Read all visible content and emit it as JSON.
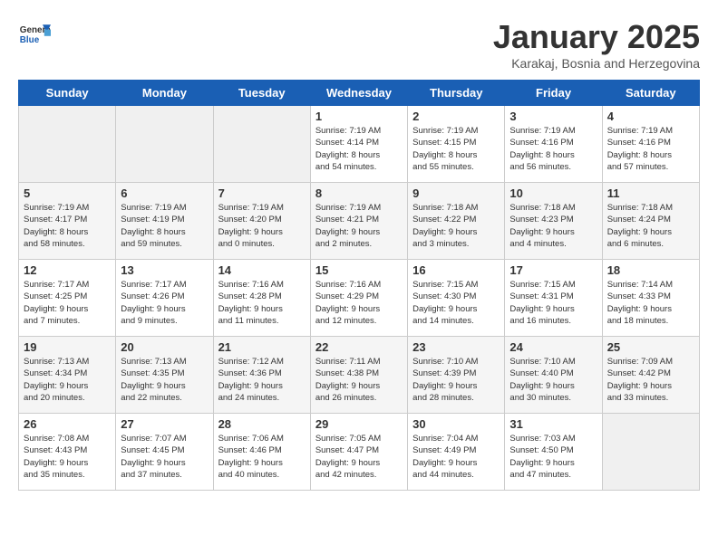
{
  "logo": {
    "general": "General",
    "blue": "Blue"
  },
  "title": "January 2025",
  "subtitle": "Karakaj, Bosnia and Herzegovina",
  "headers": [
    "Sunday",
    "Monday",
    "Tuesday",
    "Wednesday",
    "Thursday",
    "Friday",
    "Saturday"
  ],
  "weeks": [
    [
      {
        "num": "",
        "info": ""
      },
      {
        "num": "",
        "info": ""
      },
      {
        "num": "",
        "info": ""
      },
      {
        "num": "1",
        "info": "Sunrise: 7:19 AM\nSunset: 4:14 PM\nDaylight: 8 hours\nand 54 minutes."
      },
      {
        "num": "2",
        "info": "Sunrise: 7:19 AM\nSunset: 4:15 PM\nDaylight: 8 hours\nand 55 minutes."
      },
      {
        "num": "3",
        "info": "Sunrise: 7:19 AM\nSunset: 4:16 PM\nDaylight: 8 hours\nand 56 minutes."
      },
      {
        "num": "4",
        "info": "Sunrise: 7:19 AM\nSunset: 4:16 PM\nDaylight: 8 hours\nand 57 minutes."
      }
    ],
    [
      {
        "num": "5",
        "info": "Sunrise: 7:19 AM\nSunset: 4:17 PM\nDaylight: 8 hours\nand 58 minutes."
      },
      {
        "num": "6",
        "info": "Sunrise: 7:19 AM\nSunset: 4:19 PM\nDaylight: 8 hours\nand 59 minutes."
      },
      {
        "num": "7",
        "info": "Sunrise: 7:19 AM\nSunset: 4:20 PM\nDaylight: 9 hours\nand 0 minutes."
      },
      {
        "num": "8",
        "info": "Sunrise: 7:19 AM\nSunset: 4:21 PM\nDaylight: 9 hours\nand 2 minutes."
      },
      {
        "num": "9",
        "info": "Sunrise: 7:18 AM\nSunset: 4:22 PM\nDaylight: 9 hours\nand 3 minutes."
      },
      {
        "num": "10",
        "info": "Sunrise: 7:18 AM\nSunset: 4:23 PM\nDaylight: 9 hours\nand 4 minutes."
      },
      {
        "num": "11",
        "info": "Sunrise: 7:18 AM\nSunset: 4:24 PM\nDaylight: 9 hours\nand 6 minutes."
      }
    ],
    [
      {
        "num": "12",
        "info": "Sunrise: 7:17 AM\nSunset: 4:25 PM\nDaylight: 9 hours\nand 7 minutes."
      },
      {
        "num": "13",
        "info": "Sunrise: 7:17 AM\nSunset: 4:26 PM\nDaylight: 9 hours\nand 9 minutes."
      },
      {
        "num": "14",
        "info": "Sunrise: 7:16 AM\nSunset: 4:28 PM\nDaylight: 9 hours\nand 11 minutes."
      },
      {
        "num": "15",
        "info": "Sunrise: 7:16 AM\nSunset: 4:29 PM\nDaylight: 9 hours\nand 12 minutes."
      },
      {
        "num": "16",
        "info": "Sunrise: 7:15 AM\nSunset: 4:30 PM\nDaylight: 9 hours\nand 14 minutes."
      },
      {
        "num": "17",
        "info": "Sunrise: 7:15 AM\nSunset: 4:31 PM\nDaylight: 9 hours\nand 16 minutes."
      },
      {
        "num": "18",
        "info": "Sunrise: 7:14 AM\nSunset: 4:33 PM\nDaylight: 9 hours\nand 18 minutes."
      }
    ],
    [
      {
        "num": "19",
        "info": "Sunrise: 7:13 AM\nSunset: 4:34 PM\nDaylight: 9 hours\nand 20 minutes."
      },
      {
        "num": "20",
        "info": "Sunrise: 7:13 AM\nSunset: 4:35 PM\nDaylight: 9 hours\nand 22 minutes."
      },
      {
        "num": "21",
        "info": "Sunrise: 7:12 AM\nSunset: 4:36 PM\nDaylight: 9 hours\nand 24 minutes."
      },
      {
        "num": "22",
        "info": "Sunrise: 7:11 AM\nSunset: 4:38 PM\nDaylight: 9 hours\nand 26 minutes."
      },
      {
        "num": "23",
        "info": "Sunrise: 7:10 AM\nSunset: 4:39 PM\nDaylight: 9 hours\nand 28 minutes."
      },
      {
        "num": "24",
        "info": "Sunrise: 7:10 AM\nSunset: 4:40 PM\nDaylight: 9 hours\nand 30 minutes."
      },
      {
        "num": "25",
        "info": "Sunrise: 7:09 AM\nSunset: 4:42 PM\nDaylight: 9 hours\nand 33 minutes."
      }
    ],
    [
      {
        "num": "26",
        "info": "Sunrise: 7:08 AM\nSunset: 4:43 PM\nDaylight: 9 hours\nand 35 minutes."
      },
      {
        "num": "27",
        "info": "Sunrise: 7:07 AM\nSunset: 4:45 PM\nDaylight: 9 hours\nand 37 minutes."
      },
      {
        "num": "28",
        "info": "Sunrise: 7:06 AM\nSunset: 4:46 PM\nDaylight: 9 hours\nand 40 minutes."
      },
      {
        "num": "29",
        "info": "Sunrise: 7:05 AM\nSunset: 4:47 PM\nDaylight: 9 hours\nand 42 minutes."
      },
      {
        "num": "30",
        "info": "Sunrise: 7:04 AM\nSunset: 4:49 PM\nDaylight: 9 hours\nand 44 minutes."
      },
      {
        "num": "31",
        "info": "Sunrise: 7:03 AM\nSunset: 4:50 PM\nDaylight: 9 hours\nand 47 minutes."
      },
      {
        "num": "",
        "info": ""
      }
    ]
  ]
}
